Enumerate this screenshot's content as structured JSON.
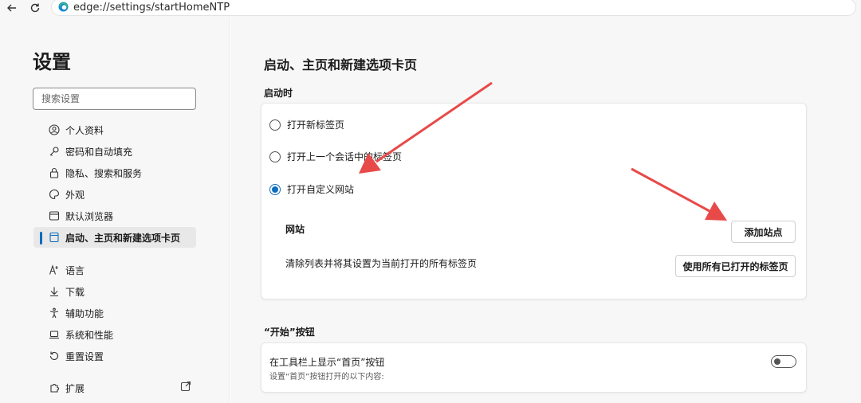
{
  "browser": {
    "url": "edge://settings/startHomeNTP",
    "back_icon": "back-arrow-icon",
    "refresh_icon": "refresh-icon",
    "edge_icon": "edge-logo-icon"
  },
  "sidebar": {
    "title": "设置",
    "search_placeholder": "搜索设置",
    "items": [
      {
        "label": "个人资料",
        "icon": "profile-icon"
      },
      {
        "label": "密码和自动填充",
        "icon": "key-icon"
      },
      {
        "label": "隐私、搜索和服务",
        "icon": "lock-icon"
      },
      {
        "label": "外观",
        "icon": "palette-icon"
      },
      {
        "label": "默认浏览器",
        "icon": "browser-icon"
      },
      {
        "label": "启动、主页和新建选项卡页",
        "icon": "tab-page-icon",
        "active": true
      },
      {
        "label": "语言",
        "icon": "language-icon"
      },
      {
        "label": "下载",
        "icon": "download-icon"
      },
      {
        "label": "辅助功能",
        "icon": "accessibility-icon"
      },
      {
        "label": "系统和性能",
        "icon": "laptop-icon"
      },
      {
        "label": "重置设置",
        "icon": "reset-icon"
      },
      {
        "label": "扩展",
        "icon": "extensions-icon"
      }
    ]
  },
  "main": {
    "title": "启动、主页和新建选项卡页",
    "startup": {
      "label": "启动时",
      "options": [
        {
          "label": "打开新标签页",
          "selected": false
        },
        {
          "label": "打开上一个会话中的标签页",
          "selected": false
        },
        {
          "label": "打开自定义网站",
          "selected": true
        }
      ],
      "sites_label": "网站",
      "add_site_button": "添加站点",
      "clear_text": "清除列表并将其设置为当前打开的所有标签页",
      "use_open_tabs_button": "使用所有已打开的标签页"
    },
    "home_button": {
      "label": "“开始”按钮",
      "toggle_title": "在工具栏上显示“首页”按钮",
      "toggle_subtitle": "设置“首页”按钮打开的以下内容:",
      "enabled": false
    }
  },
  "colors": {
    "accent": "#0f6cbd",
    "annotation_arrow": "#e84a4a",
    "background": "#f7f7f7"
  }
}
